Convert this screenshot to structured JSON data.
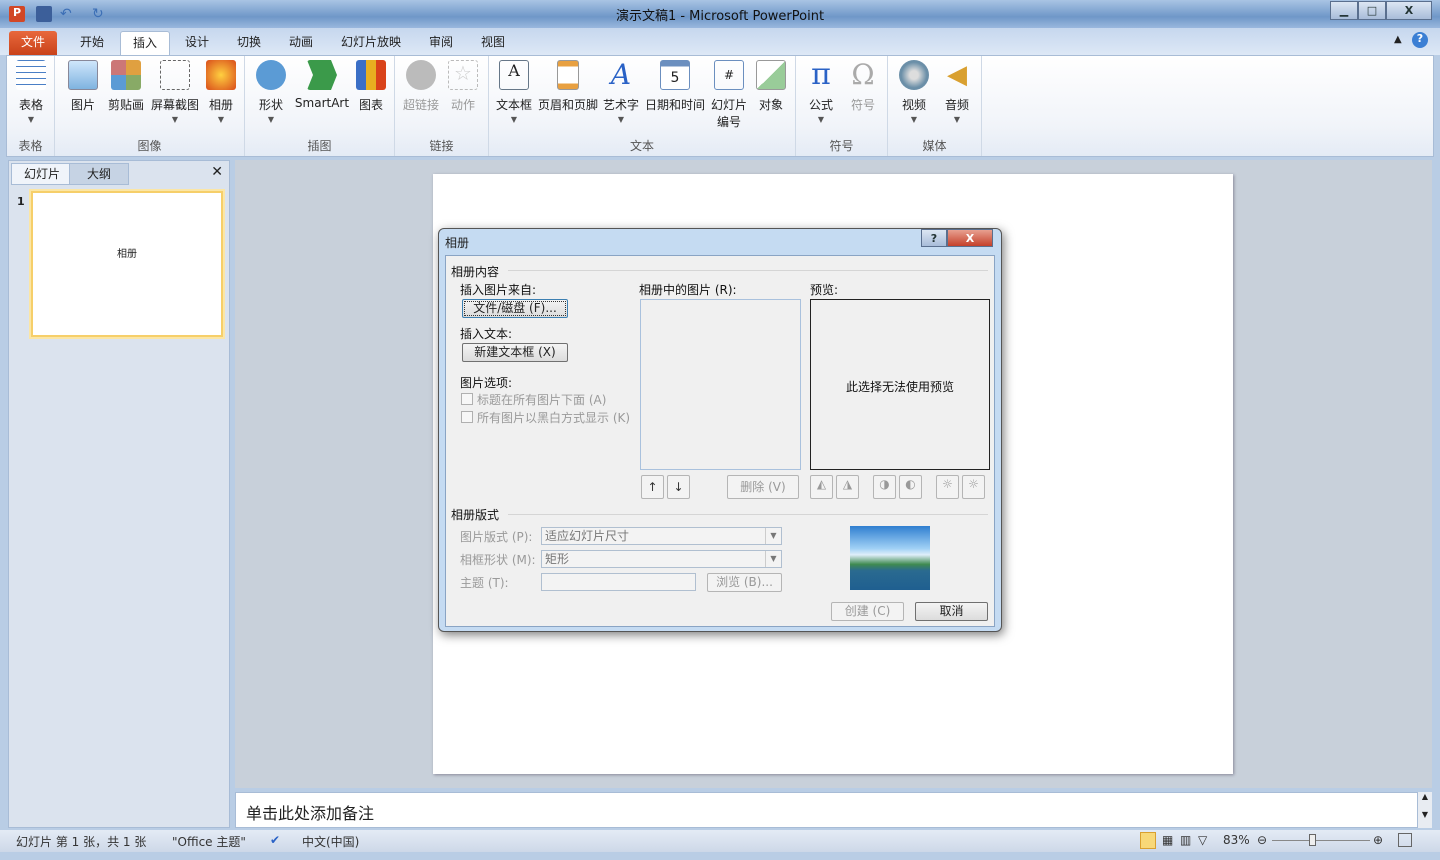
{
  "window": {
    "title": "演示文稿1 - Microsoft PowerPoint",
    "min": "▁",
    "max": "□",
    "close": "X"
  },
  "tabs": [
    "文件",
    "开始",
    "插入",
    "设计",
    "切换",
    "动画",
    "幻灯片放映",
    "审阅",
    "视图"
  ],
  "ribbon": {
    "groups": [
      {
        "label": "表格",
        "buttons": [
          {
            "label": "表格",
            "color": "#4a7fc6"
          }
        ]
      },
      {
        "label": "图像",
        "buttons": [
          {
            "label": "图片",
            "color": "#7fb3e0"
          },
          {
            "label": "剪贴画",
            "color": "#e0a040"
          },
          {
            "label": "屏幕截图",
            "color": "#666"
          },
          {
            "label": "相册",
            "color": "#d94c1a"
          }
        ]
      },
      {
        "label": "插图",
        "buttons": [
          {
            "label": "形状",
            "color": "#5b9bd5"
          },
          {
            "label": "SmartArt",
            "color": "#3b9a4a"
          },
          {
            "label": "图表",
            "color": "#d9431a"
          }
        ]
      },
      {
        "label": "链接",
        "buttons": [
          {
            "label": "超链接",
            "color": "#bbb"
          },
          {
            "label": "动作",
            "color": "#ccc"
          }
        ]
      },
      {
        "label": "文本",
        "buttons": [
          {
            "label": "文本框",
            "color": "#456"
          },
          {
            "label": "页眉和页脚",
            "color": "#e8a040"
          },
          {
            "label": "艺术字",
            "color": "#2a62c6"
          },
          {
            "label": "日期和时间",
            "color": "#6b8fbf"
          },
          {
            "label": "幻灯片编号",
            "color": "#6b8fbf"
          },
          {
            "label": "对象",
            "color": "#5aa05a"
          }
        ]
      },
      {
        "label": "符号",
        "buttons": [
          {
            "label": "公式",
            "color": "#2a62c6"
          },
          {
            "label": "符号",
            "color": "#aaa"
          }
        ]
      },
      {
        "label": "媒体",
        "buttons": [
          {
            "label": "视频",
            "color": "#6b8fa8"
          },
          {
            "label": "音频",
            "color": "#d9a030"
          }
        ]
      }
    ]
  },
  "leftpane": {
    "tabs": [
      "幻灯片",
      "大纲"
    ],
    "slide_number": "1",
    "thumb_text": "相册",
    "close": "✕"
  },
  "notes": {
    "placeholder": "单击此处添加备注"
  },
  "status": {
    "slide": "幻灯片 第 1 张，共 1 张",
    "theme": "\"Office 主题\"",
    "language": "中文(中国)",
    "zoom": "83%",
    "zoom_value": 83
  },
  "dialog": {
    "title": "相册",
    "help": "?",
    "close": "X",
    "content_section": "相册内容",
    "insert_from": "插入图片来自:",
    "file_button": "文件/磁盘 (F)...",
    "insert_text": "插入文本:",
    "new_textbox": "新建文本框 (X)",
    "picture_options": "图片选项:",
    "opt_caption": "标题在所有图片下面 (A)",
    "opt_bw": "所有图片以黑白方式显示 (K)",
    "pictures_label": "相册中的图片 (R):",
    "preview_label": "预览:",
    "preview_text": "此选择无法使用预览",
    "up": "↑",
    "down": "↓",
    "delete": "删除 (V)",
    "layout_section": "相册版式",
    "picture_layout_label": "图片版式 (P):",
    "picture_layout_value": "适应幻灯片尺寸",
    "frame_shape_label": "相框形状 (M):",
    "frame_shape_value": "矩形",
    "theme_label": "主题 (T):",
    "theme_value": "",
    "browse": "浏览 (B)...",
    "create": "创建 (C)",
    "cancel": "取消"
  }
}
